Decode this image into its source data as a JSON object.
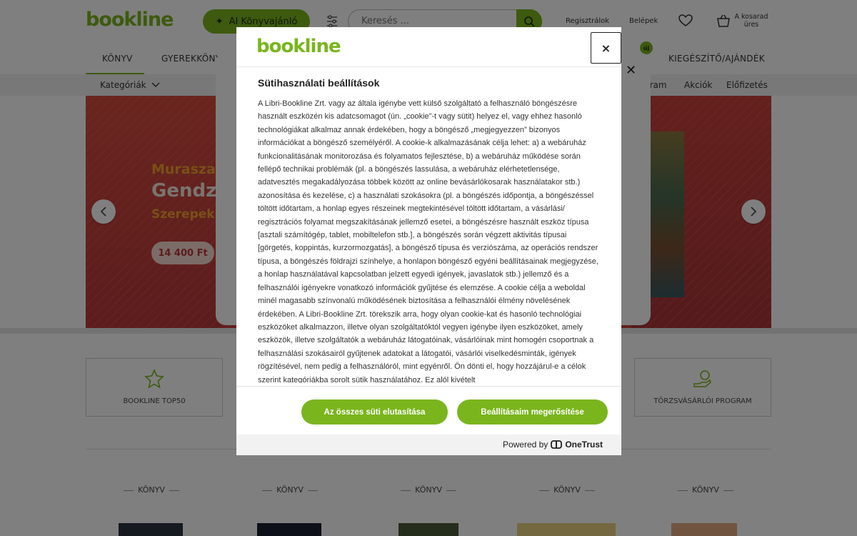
{
  "header": {
    "logo": "bookline",
    "ai_button_label": "AI Könyvajánló",
    "search_placeholder": "Keresés ...",
    "register_label": "Regisztrálok",
    "login_label": "Belépek",
    "cart_label": "A kosarad üres"
  },
  "nav": {
    "items": [
      "KÖNYV",
      "GYEREKKÖNYV",
      "KIEGÉSZÍTŐ/AJÁNDÉK"
    ],
    "new_badge": "új"
  },
  "subnav": {
    "categories_label": "Kategóriák",
    "items": [
      "gram",
      "Akciók",
      "Előfizetés"
    ]
  },
  "banner": {
    "line1": "Muraszak",
    "line2": "Gendzs",
    "line3": "Szerepek",
    "price": "14 400 Ft"
  },
  "tiles": [
    "BOOKLINE TOP50",
    "TÖRZSVÁSÁRLÓI PROGRAM"
  ],
  "book_categories": [
    "KÖNYV",
    "KÖNYV",
    "KÖNYV",
    "KÖNYV",
    "KÖNYV"
  ],
  "modal": {
    "logo": "bookline",
    "close_label": "×",
    "title": "Sütihasználati beállítások",
    "body": "A Libri-Bookline Zrt. vagy az általa igénybe vett külső szolgáltató a felhasználó böngészésre használt eszközén kis adatcsomagot (ún. „cookie”-t vagy sütit) helyez el, vagy ehhez hasonló technológiákat alkalmaz annak érdekében, hogy a böngésző „megjegyezzen” bizonyos információkat a böngésző személyéről. A cookie-k alkalmazásának célja lehet: a) a webáruház funkcionalitásának monitorozása és folyamatos fejlesztése, b) a webáruház működése során fellépő technikai problémák (pl. a böngészés lassulása, a webáruház elérhetetlensége, adatvesztés megakadályozása többek között az online bevásárlókosarak használatakor stb.) azonosítása és kezelése, c) a használati szokásokra (pl. a böngészés időpontja, a böngészéssel töltött időtartam, a honlap egyes részeinek megtekintésével töltött időtartam, a vásárlási/ regisztrációs folyamat megszakításának jellemző esetei, a böngészésre használt eszköz típusa [asztali számítógép, tablet, mobiltelefon stb.], a böngészés során végzett aktivitás típusai [görgetés, koppintás, kurzormozgatás], a böngésző típusa és verziószáma, az operációs rendszer típusa, a böngészés földrajzi színhelye, a honlapon böngésző egyéni beállításainak megjegyzése, a honlap használatával kapcsolatban jelzett egyedi igények, javaslatok stb.) jellemző és a felhasználói igényekre vonatkozó információk gyűjtése és elemzése. A cookie célja a weboldal minél magasabb színvonalú működésének biztosítása a felhasználói élmény növelésének érdekében. A Libri-Bookline Zrt. törekszik arra, hogy olyan cookie-kat és hasonló technológiai eszközöket alkalmazzon, illetve olyan szolgáltatóktól vegyen igénybe ilyen eszközöket, amely eszközök, illetve szolgáltatók a webáruház látogatóinak, vásárlóinak mint homogén csoportnak a felhasználási szokásairól gyűjtenek adatokat a látogatói, vásárlói viselkedésminták, igények rögzítésével, nem pedig a felhasználóról, mint egyénről. Ön dönti el, hogy hozzájárul-e a célok szerint kategóriákba sorolt sütik használatához. Ez alól kivételt",
    "reject_button": "Az összes süti elutasítása",
    "confirm_button": "Beállításaim megerősítése",
    "powered_by": "Powered by",
    "powered_brand": "OneTrust"
  },
  "colors": {
    "brand_green": "#7ab51d",
    "overlay": "rgba(0,0,0,0.5)"
  },
  "icons": [
    "sparkle-icon",
    "filter-icon",
    "search-icon",
    "heart-icon",
    "cart-icon",
    "chevron-down-icon",
    "chevron-left-icon",
    "chevron-right-icon",
    "star-icon",
    "hand-coin-icon",
    "close-icon",
    "onetrust-logo-icon"
  ]
}
